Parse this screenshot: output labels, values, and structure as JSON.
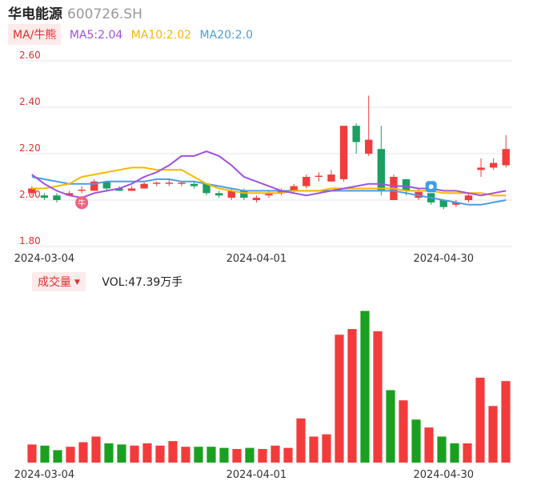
{
  "header": {
    "name": "华电能源",
    "code": "600726.SH"
  },
  "ma_legend": {
    "tag": "MA/牛熊",
    "items": [
      {
        "label": "MA5:2.04",
        "color": "#a050e0"
      },
      {
        "label": "MA10:2.02",
        "color": "#f5b800"
      },
      {
        "label": "MA20:2.0",
        "color": "#4a9be8"
      }
    ]
  },
  "volume_legend": {
    "tag": "成交量",
    "text": "VOL:47.39万手"
  },
  "colors": {
    "up": "#f23c3c",
    "down": "#1aa060",
    "vol_up": "#f23c3c",
    "vol_down": "#1aa020",
    "grid": "#e6e6e6"
  },
  "icons": {
    "bull_marker": "bull-icon",
    "bear_marker": "bear-icon"
  },
  "chart_data": [
    {
      "type": "candlestick",
      "title": "",
      "y_ticks": [
        "2.60",
        "2.40",
        "2.20",
        "2.00",
        "1.80"
      ],
      "ylim": [
        1.8,
        2.6
      ],
      "x_tick_labels": [
        {
          "label": "2024-03-04",
          "index": 1
        },
        {
          "label": "2024-04-01",
          "index": 18
        },
        {
          "label": "2024-04-30",
          "index": 33
        }
      ],
      "markers": [
        {
          "type": "bull",
          "label": "牛",
          "index": 4
        },
        {
          "type": "bear",
          "index": 32
        }
      ],
      "candles": [
        {
          "o": 2.03,
          "c": 2.05,
          "h": 2.06,
          "l": 2.02
        },
        {
          "o": 2.02,
          "c": 2.01,
          "h": 2.03,
          "l": 2.0
        },
        {
          "o": 2.02,
          "c": 2.0,
          "h": 2.03,
          "l": 1.99
        },
        {
          "o": 2.02,
          "c": 2.03,
          "h": 2.04,
          "l": 2.02
        },
        {
          "o": 2.04,
          "c": 2.045,
          "h": 2.06,
          "l": 2.03
        },
        {
          "o": 2.04,
          "c": 2.08,
          "h": 2.09,
          "l": 2.04
        },
        {
          "o": 2.08,
          "c": 2.05,
          "h": 2.08,
          "l": 2.04
        },
        {
          "o": 2.05,
          "c": 2.04,
          "h": 2.06,
          "l": 2.04
        },
        {
          "o": 2.04,
          "c": 2.05,
          "h": 2.06,
          "l": 2.04
        },
        {
          "o": 2.05,
          "c": 2.07,
          "h": 2.08,
          "l": 2.05
        },
        {
          "o": 2.07,
          "c": 2.075,
          "h": 2.08,
          "l": 2.06
        },
        {
          "o": 2.07,
          "c": 2.075,
          "h": 2.09,
          "l": 2.06
        },
        {
          "o": 2.07,
          "c": 2.075,
          "h": 2.08,
          "l": 2.06
        },
        {
          "o": 2.07,
          "c": 2.06,
          "h": 2.08,
          "l": 2.05
        },
        {
          "o": 2.07,
          "c": 2.03,
          "h": 2.07,
          "l": 2.02
        },
        {
          "o": 2.03,
          "c": 2.02,
          "h": 2.04,
          "l": 2.01
        },
        {
          "o": 2.01,
          "c": 2.04,
          "h": 2.05,
          "l": 2.0
        },
        {
          "o": 2.04,
          "c": 2.01,
          "h": 2.05,
          "l": 2.0
        },
        {
          "o": 2.0,
          "c": 2.01,
          "h": 2.02,
          "l": 1.99
        },
        {
          "o": 2.02,
          "c": 2.03,
          "h": 2.04,
          "l": 2.01
        },
        {
          "o": 2.03,
          "c": 2.04,
          "h": 2.05,
          "l": 2.02
        },
        {
          "o": 2.04,
          "c": 2.06,
          "h": 2.07,
          "l": 2.03
        },
        {
          "o": 2.06,
          "c": 2.1,
          "h": 2.11,
          "l": 2.05
        },
        {
          "o": 2.1,
          "c": 2.105,
          "h": 2.12,
          "l": 2.08
        },
        {
          "o": 2.08,
          "c": 2.11,
          "h": 2.13,
          "l": 2.08
        },
        {
          "o": 2.09,
          "c": 2.32,
          "h": 2.32,
          "l": 2.08
        },
        {
          "o": 2.32,
          "c": 2.25,
          "h": 2.33,
          "l": 2.2
        },
        {
          "o": 2.2,
          "c": 2.26,
          "h": 2.45,
          "l": 2.19
        },
        {
          "o": 2.22,
          "c": 2.04,
          "h": 2.32,
          "l": 2.02
        },
        {
          "o": 2.0,
          "c": 2.1,
          "h": 2.11,
          "l": 2.0
        },
        {
          "o": 2.09,
          "c": 2.04,
          "h": 2.09,
          "l": 2.02
        },
        {
          "o": 2.01,
          "c": 2.035,
          "h": 2.05,
          "l": 2.0
        },
        {
          "o": 2.03,
          "c": 1.99,
          "h": 2.03,
          "l": 1.98
        },
        {
          "o": 2.0,
          "c": 1.97,
          "h": 2.0,
          "l": 1.96
        },
        {
          "o": 1.98,
          "c": 1.99,
          "h": 2.0,
          "l": 1.97
        },
        {
          "o": 2.0,
          "c": 2.02,
          "h": 2.03,
          "l": 1.99
        },
        {
          "o": 2.13,
          "c": 2.14,
          "h": 2.18,
          "l": 2.1
        },
        {
          "o": 2.14,
          "c": 2.16,
          "h": 2.18,
          "l": 2.13
        },
        {
          "o": 2.15,
          "c": 2.22,
          "h": 2.28,
          "l": 2.14
        }
      ],
      "ma5": [
        2.11,
        2.07,
        2.04,
        2.02,
        2.01,
        2.03,
        2.04,
        2.05,
        2.07,
        2.1,
        2.12,
        2.15,
        2.19,
        2.19,
        2.21,
        2.19,
        2.15,
        2.1,
        2.08,
        2.06,
        2.04,
        2.03,
        2.02,
        2.03,
        2.04,
        2.05,
        2.06,
        2.07,
        2.07,
        2.06,
        2.06,
        2.05,
        2.05,
        2.04,
        2.04,
        2.03,
        2.02,
        2.03,
        2.04
      ],
      "ma10": [
        2.05,
        2.05,
        2.06,
        2.07,
        2.1,
        2.11,
        2.12,
        2.13,
        2.14,
        2.14,
        2.13,
        2.13,
        2.13,
        2.1,
        2.07,
        2.05,
        2.04,
        2.03,
        2.03,
        2.03,
        2.03,
        2.04,
        2.04,
        2.04,
        2.05,
        2.05,
        2.05,
        2.05,
        2.05,
        2.05,
        2.04,
        2.04,
        2.04,
        2.03,
        2.03,
        2.03,
        2.03,
        2.02,
        2.02
      ],
      "ma20": [
        2.1,
        2.09,
        2.08,
        2.07,
        2.07,
        2.07,
        2.08,
        2.08,
        2.08,
        2.08,
        2.09,
        2.09,
        2.08,
        2.08,
        2.07,
        2.06,
        2.05,
        2.04,
        2.04,
        2.04,
        2.04,
        2.04,
        2.04,
        2.04,
        2.04,
        2.04,
        2.04,
        2.04,
        2.04,
        2.04,
        2.03,
        2.02,
        2.01,
        2.0,
        1.99,
        1.98,
        1.98,
        1.99,
        2.0
      ],
      "volume": [
        16,
        15,
        11,
        14,
        18,
        23,
        17,
        16,
        15,
        17,
        15,
        19,
        14,
        14,
        14,
        13,
        12,
        13,
        12,
        15,
        13,
        39,
        23,
        25,
        113,
        118,
        134,
        116,
        64,
        55,
        38,
        31,
        23,
        17,
        17,
        75,
        50,
        72
      ]
    }
  ]
}
